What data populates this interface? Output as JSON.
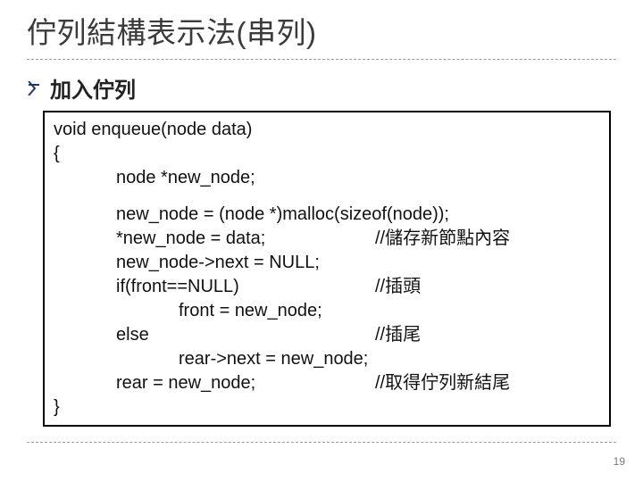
{
  "title": "佇列結構表示法(串列)",
  "subtitle": "加入佇列",
  "code": {
    "l1": "void enqueue(node data)",
    "l2": "{",
    "l3": "node *new_node;",
    "l4": "new_node = (node *)malloc(sizeof(node));",
    "l5": "*new_node = data;",
    "c5": "//儲存新節點內容",
    "l6": "new_node->next = NULL;",
    "l7": "if(front==NULL)",
    "c7": "//插頭",
    "l8": "front = new_node;",
    "l9": "else",
    "c9": "//插尾",
    "l10": "rear->next = new_node;",
    "l11": "rear = new_node;",
    "c11": "//取得佇列新結尾",
    "l12": "}"
  },
  "page": "19"
}
